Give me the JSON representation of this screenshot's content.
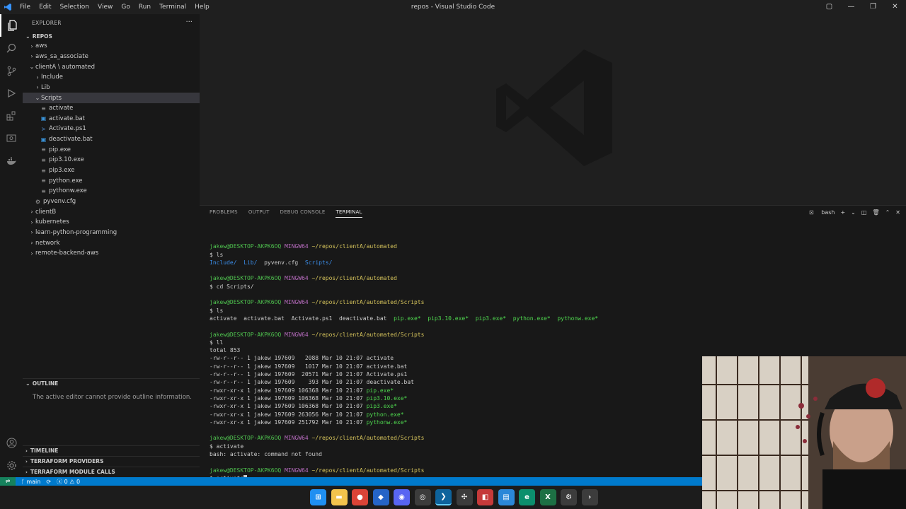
{
  "titlebar": {
    "menu": [
      "File",
      "Edit",
      "Selection",
      "View",
      "Go",
      "Run",
      "Terminal",
      "Help"
    ],
    "title": "repos - Visual Studio Code"
  },
  "activitybar": {
    "icons": [
      "explorer-icon",
      "search-icon",
      "source-control-icon",
      "run-debug-icon",
      "extensions-icon",
      "remote-explorer-icon",
      "docker-icon",
      "account-icon",
      "settings-icon"
    ]
  },
  "sidebar": {
    "header": "EXPLORER",
    "root": "REPOS",
    "tree": [
      {
        "label": "aws",
        "type": "folder",
        "depth": 0,
        "open": false
      },
      {
        "label": "aws_sa_associate",
        "type": "folder",
        "depth": 0,
        "open": false
      },
      {
        "label": "clientA \\ automated",
        "type": "folder",
        "depth": 0,
        "open": true
      },
      {
        "label": "Include",
        "type": "folder",
        "depth": 1,
        "open": false
      },
      {
        "label": "Lib",
        "type": "folder",
        "depth": 1,
        "open": false
      },
      {
        "label": "Scripts",
        "type": "folder",
        "depth": 1,
        "open": true,
        "selected": true
      },
      {
        "label": "activate",
        "type": "file",
        "depth": 2,
        "icon": "lines"
      },
      {
        "label": "activate.bat",
        "type": "file",
        "depth": 2,
        "icon": "bat"
      },
      {
        "label": "Activate.ps1",
        "type": "file",
        "depth": 2,
        "icon": "ps"
      },
      {
        "label": "deactivate.bat",
        "type": "file",
        "depth": 2,
        "icon": "bat"
      },
      {
        "label": "pip.exe",
        "type": "file",
        "depth": 2,
        "icon": "lines"
      },
      {
        "label": "pip3.10.exe",
        "type": "file",
        "depth": 2,
        "icon": "lines"
      },
      {
        "label": "pip3.exe",
        "type": "file",
        "depth": 2,
        "icon": "lines"
      },
      {
        "label": "python.exe",
        "type": "file",
        "depth": 2,
        "icon": "lines"
      },
      {
        "label": "pythonw.exe",
        "type": "file",
        "depth": 2,
        "icon": "lines"
      },
      {
        "label": "pyvenv.cfg",
        "type": "file",
        "depth": 1,
        "icon": "gear"
      },
      {
        "label": "clientB",
        "type": "folder",
        "depth": 0,
        "open": false
      },
      {
        "label": "kubernetes",
        "type": "folder",
        "depth": 0,
        "open": false
      },
      {
        "label": "learn-python-programming",
        "type": "folder",
        "depth": 0,
        "open": false
      },
      {
        "label": "network",
        "type": "folder",
        "depth": 0,
        "open": false
      },
      {
        "label": "remote-backend-aws",
        "type": "folder",
        "depth": 0,
        "open": false
      }
    ],
    "outline_title": "OUTLINE",
    "outline_message": "The active editor cannot provide outline information.",
    "bottom_sections": [
      "TIMELINE",
      "TERRAFORM PROVIDERS",
      "TERRAFORM MODULE CALLS"
    ]
  },
  "panel": {
    "tabs": [
      "PROBLEMS",
      "OUTPUT",
      "DEBUG CONSOLE",
      "TERMINAL"
    ],
    "active_tab": "TERMINAL",
    "shell": "bash",
    "terminal_lines": [
      [],
      [
        {
          "t": "jakew@DESKTOP-AKPK6OQ",
          "c": "user"
        },
        {
          "t": " "
        },
        {
          "t": "MINGW64",
          "c": "host"
        },
        {
          "t": " "
        },
        {
          "t": "~/repos/clientA/automated",
          "c": "path"
        }
      ],
      [
        {
          "t": "$ ls"
        }
      ],
      [
        {
          "t": "Include/",
          "c": "dir"
        },
        {
          "t": "  "
        },
        {
          "t": "Lib/",
          "c": "dir"
        },
        {
          "t": "  pyvenv.cfg  "
        },
        {
          "t": "Scripts/",
          "c": "dir"
        }
      ],
      [],
      [
        {
          "t": "jakew@DESKTOP-AKPK6OQ",
          "c": "user"
        },
        {
          "t": " "
        },
        {
          "t": "MINGW64",
          "c": "host"
        },
        {
          "t": " "
        },
        {
          "t": "~/repos/clientA/automated",
          "c": "path"
        }
      ],
      [
        {
          "t": "$ cd Scripts/"
        }
      ],
      [],
      [
        {
          "t": "jakew@DESKTOP-AKPK6OQ",
          "c": "user"
        },
        {
          "t": " "
        },
        {
          "t": "MINGW64",
          "c": "host"
        },
        {
          "t": " "
        },
        {
          "t": "~/repos/clientA/automated/Scripts",
          "c": "path"
        }
      ],
      [
        {
          "t": "$ ls"
        }
      ],
      [
        {
          "t": "activate  activate.bat  Activate.ps1  deactivate.bat  "
        },
        {
          "t": "pip.exe*",
          "c": "exe"
        },
        {
          "t": "  "
        },
        {
          "t": "pip3.10.exe*",
          "c": "exe"
        },
        {
          "t": "  "
        },
        {
          "t": "pip3.exe*",
          "c": "exe"
        },
        {
          "t": "  "
        },
        {
          "t": "python.exe*",
          "c": "exe"
        },
        {
          "t": "  "
        },
        {
          "t": "pythonw.exe*",
          "c": "exe"
        }
      ],
      [],
      [
        {
          "t": "jakew@DESKTOP-AKPK6OQ",
          "c": "user"
        },
        {
          "t": " "
        },
        {
          "t": "MINGW64",
          "c": "host"
        },
        {
          "t": " "
        },
        {
          "t": "~/repos/clientA/automated/Scripts",
          "c": "path"
        }
      ],
      [
        {
          "t": "$ ll"
        }
      ],
      [
        {
          "t": "total 853"
        }
      ],
      [
        {
          "t": "-rw-r--r-- 1 jakew 197609   2088 Mar 10 21:07 activate"
        }
      ],
      [
        {
          "t": "-rw-r--r-- 1 jakew 197609   1017 Mar 10 21:07 activate.bat"
        }
      ],
      [
        {
          "t": "-rw-r--r-- 1 jakew 197609  20571 Mar 10 21:07 Activate.ps1"
        }
      ],
      [
        {
          "t": "-rw-r--r-- 1 jakew 197609    393 Mar 10 21:07 deactivate.bat"
        }
      ],
      [
        {
          "t": "-rwxr-xr-x 1 jakew 197609 106368 Mar 10 21:07 "
        },
        {
          "t": "pip.exe*",
          "c": "exe"
        }
      ],
      [
        {
          "t": "-rwxr-xr-x 1 jakew 197609 106368 Mar 10 21:07 "
        },
        {
          "t": "pip3.10.exe*",
          "c": "exe"
        }
      ],
      [
        {
          "t": "-rwxr-xr-x 1 jakew 197609 106368 Mar 10 21:07 "
        },
        {
          "t": "pip3.exe*",
          "c": "exe"
        }
      ],
      [
        {
          "t": "-rwxr-xr-x 1 jakew 197609 263056 Mar 10 21:07 "
        },
        {
          "t": "python.exe*",
          "c": "exe"
        }
      ],
      [
        {
          "t": "-rwxr-xr-x 1 jakew 197609 251792 Mar 10 21:07 "
        },
        {
          "t": "pythonw.exe*",
          "c": "exe"
        }
      ],
      [],
      [
        {
          "t": "jakew@DESKTOP-AKPK6OQ",
          "c": "user"
        },
        {
          "t": " "
        },
        {
          "t": "MINGW64",
          "c": "host"
        },
        {
          "t": " "
        },
        {
          "t": "~/repos/clientA/automated/Scripts",
          "c": "path"
        }
      ],
      [
        {
          "t": "$ activate"
        }
      ],
      [
        {
          "t": "bash: activate: command not found"
        }
      ],
      [],
      [
        {
          "t": "jakew@DESKTOP-AKPK6OQ",
          "c": "user"
        },
        {
          "t": " "
        },
        {
          "t": "MINGW64",
          "c": "host"
        },
        {
          "t": " "
        },
        {
          "t": "~/repos/clientA/automated/Scripts",
          "c": "path"
        }
      ],
      [
        {
          "t": "$ activate"
        },
        {
          "t": "",
          "c": "cursor"
        }
      ]
    ]
  },
  "statusbar": {
    "branch": "main",
    "errors": "0",
    "warnings": "0"
  },
  "taskbar": {
    "apps": [
      {
        "name": "windows-start-icon",
        "color": "#1f8ff1",
        "glyph": "⊞"
      },
      {
        "name": "file-explorer-icon",
        "color": "#f2c34c",
        "glyph": "▬"
      },
      {
        "name": "chrome-icon",
        "color": "#db4437",
        "glyph": "●"
      },
      {
        "name": "app-blue-icon",
        "color": "#2564c7",
        "glyph": "◆"
      },
      {
        "name": "discord-icon",
        "color": "#5865f2",
        "glyph": "◉"
      },
      {
        "name": "obs-icon",
        "color": "#3c3c3c",
        "glyph": "◎"
      },
      {
        "name": "vscode-icon",
        "color": "#0e639c",
        "glyph": "❯"
      },
      {
        "name": "slack-icon",
        "color": "#3c3c3c",
        "glyph": "✣"
      },
      {
        "name": "app-red-icon",
        "color": "#c53a3a",
        "glyph": "◧"
      },
      {
        "name": "notepad-icon",
        "color": "#2b88d8",
        "glyph": "▤"
      },
      {
        "name": "edge-icon",
        "color": "#0c8f6d",
        "glyph": "e"
      },
      {
        "name": "excel-icon",
        "color": "#1d7044",
        "glyph": "X"
      },
      {
        "name": "settings-gear-icon",
        "color": "#3c3c3c",
        "glyph": "⚙"
      },
      {
        "name": "terminal-icon",
        "color": "#3c3c3c",
        "glyph": "›"
      }
    ]
  }
}
